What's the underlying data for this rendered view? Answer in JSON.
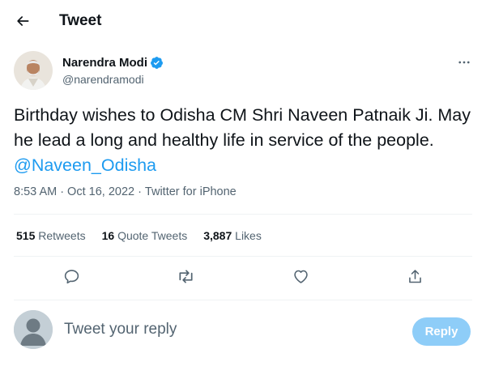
{
  "header": {
    "title": "Tweet"
  },
  "author": {
    "name": "Narendra Modi",
    "handle": "@narendramodi",
    "verified": true
  },
  "tweet": {
    "text": "Birthday wishes to Odisha CM Shri Naveen Patnaik Ji. May he lead a long and healthy life in service of the people.",
    "mention": "@Naveen_Odisha"
  },
  "meta": {
    "time": "8:53 AM",
    "separator": "·",
    "date": "Oct 16, 2022",
    "source": "Twitter for iPhone"
  },
  "stats": {
    "retweets_count": "515",
    "retweets_label": "Retweets",
    "quote_count": "16",
    "quote_label": "Quote Tweets",
    "likes_count": "3,887",
    "likes_label": "Likes"
  },
  "reply": {
    "placeholder": "Tweet your reply",
    "button_label": "Reply"
  },
  "colors": {
    "accent": "#1d9bf0",
    "reply_button_disabled": "#8ecdf8",
    "secondary_text": "#536471"
  }
}
